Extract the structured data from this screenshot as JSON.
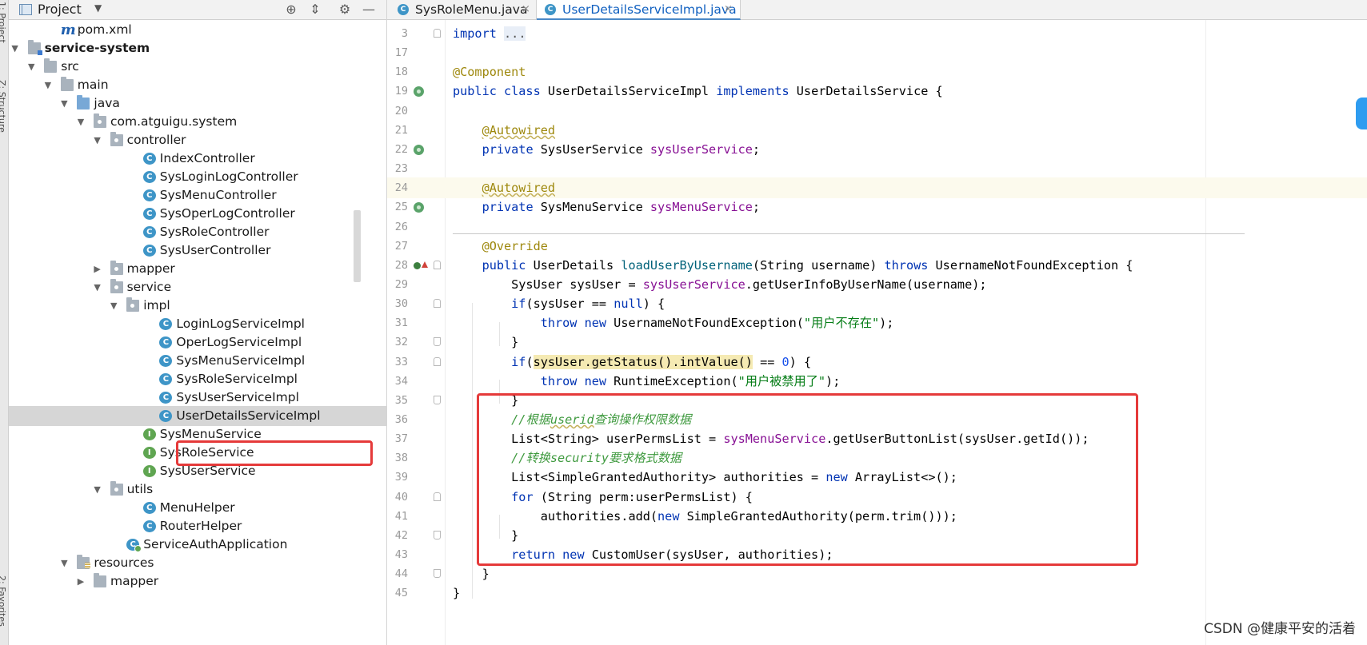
{
  "side_strip": {
    "tabs": [
      {
        "label": "1: Project",
        "icon": "project-tab"
      },
      {
        "label": "Z: Structure",
        "icon": "structure-tab"
      },
      {
        "label": "2: Favorites",
        "icon": "favorites-tab"
      }
    ]
  },
  "project_panel": {
    "title": "Project",
    "header_icons": [
      "locate-icon",
      "collapse-all-icon",
      "gear-icon",
      "minimize-icon"
    ],
    "tree": [
      {
        "label": "pom.xml",
        "icon": "maven-file-icon",
        "depth": 3,
        "arrow": ""
      },
      {
        "label": "service-system",
        "icon": "module-folder-icon",
        "depth": 1,
        "arrow": "open",
        "bold": true
      },
      {
        "label": "src",
        "icon": "folder-icon",
        "depth": 2,
        "arrow": "open"
      },
      {
        "label": "main",
        "icon": "folder-icon",
        "depth": 3,
        "arrow": "open"
      },
      {
        "label": "java",
        "icon": "source-folder-icon",
        "depth": 4,
        "arrow": "open"
      },
      {
        "label": "com.atguigu.system",
        "icon": "package-icon",
        "depth": 5,
        "arrow": "open"
      },
      {
        "label": "controller",
        "icon": "package-icon",
        "depth": 6,
        "arrow": "open"
      },
      {
        "label": "IndexController",
        "icon": "class-icon",
        "depth": 8,
        "arrow": ""
      },
      {
        "label": "SysLoginLogController",
        "icon": "class-icon",
        "depth": 8,
        "arrow": ""
      },
      {
        "label": "SysMenuController",
        "icon": "class-icon",
        "depth": 8,
        "arrow": ""
      },
      {
        "label": "SysOperLogController",
        "icon": "class-icon",
        "depth": 8,
        "arrow": ""
      },
      {
        "label": "SysRoleController",
        "icon": "class-icon",
        "depth": 8,
        "arrow": ""
      },
      {
        "label": "SysUserController",
        "icon": "class-icon",
        "depth": 8,
        "arrow": ""
      },
      {
        "label": "mapper",
        "icon": "package-icon",
        "depth": 6,
        "arrow": "closed"
      },
      {
        "label": "service",
        "icon": "package-icon",
        "depth": 6,
        "arrow": "open"
      },
      {
        "label": "impl",
        "icon": "package-icon",
        "depth": 7,
        "arrow": "open"
      },
      {
        "label": "LoginLogServiceImpl",
        "icon": "class-icon",
        "depth": 9,
        "arrow": ""
      },
      {
        "label": "OperLogServiceImpl",
        "icon": "class-icon",
        "depth": 9,
        "arrow": ""
      },
      {
        "label": "SysMenuServiceImpl",
        "icon": "class-icon",
        "depth": 9,
        "arrow": ""
      },
      {
        "label": "SysRoleServiceImpl",
        "icon": "class-icon",
        "depth": 9,
        "arrow": ""
      },
      {
        "label": "SysUserServiceImpl",
        "icon": "class-icon",
        "depth": 9,
        "arrow": ""
      },
      {
        "label": "UserDetailsServiceImpl",
        "icon": "class-icon",
        "depth": 9,
        "arrow": "",
        "selected": true,
        "highlighted": true
      },
      {
        "label": "SysMenuService",
        "icon": "interface-icon",
        "depth": 8,
        "arrow": ""
      },
      {
        "label": "SysRoleService",
        "icon": "interface-icon",
        "depth": 8,
        "arrow": ""
      },
      {
        "label": "SysUserService",
        "icon": "interface-icon",
        "depth": 8,
        "arrow": ""
      },
      {
        "label": "utils",
        "icon": "package-icon",
        "depth": 6,
        "arrow": "open"
      },
      {
        "label": "MenuHelper",
        "icon": "class-icon",
        "depth": 8,
        "arrow": ""
      },
      {
        "label": "RouterHelper",
        "icon": "class-icon",
        "depth": 8,
        "arrow": ""
      },
      {
        "label": "ServiceAuthApplication",
        "icon": "spring-app-icon",
        "depth": 7,
        "arrow": ""
      },
      {
        "label": "resources",
        "icon": "resources-folder-icon",
        "depth": 4,
        "arrow": "open"
      },
      {
        "label": "mapper",
        "icon": "folder-icon",
        "depth": 5,
        "arrow": "closed"
      }
    ]
  },
  "editor": {
    "tabs": [
      {
        "label": "SysRoleMenu.java",
        "active": false
      },
      {
        "label": "UserDetailsServiceImpl.java",
        "active": true
      }
    ],
    "close_glyph": "×",
    "lines": [
      {
        "num": "3",
        "fold": "open",
        "tokens": [
          [
            "kw",
            "import"
          ],
          [
            "p",
            " "
          ],
          [
            "foldtext",
            "..."
          ]
        ]
      },
      {
        "num": "17",
        "tokens": []
      },
      {
        "num": "18",
        "tokens": [
          [
            "ann",
            "@Component"
          ]
        ]
      },
      {
        "num": "19",
        "gutter": "bean",
        "tokens": [
          [
            "kw",
            "public class "
          ],
          [
            "p",
            "UserDetailsServiceImpl "
          ],
          [
            "kw",
            "implements "
          ],
          [
            "p",
            "UserDetailsService {"
          ]
        ]
      },
      {
        "num": "20",
        "tokens": []
      },
      {
        "num": "21",
        "tokens": [
          [
            "p",
            "    "
          ],
          [
            "annsq",
            "@Autowired"
          ]
        ]
      },
      {
        "num": "22",
        "gutter": "bean",
        "tokens": [
          [
            "p",
            "    "
          ],
          [
            "kw",
            "private "
          ],
          [
            "p",
            "SysUserService "
          ],
          [
            "fld",
            "sysUserService"
          ],
          [
            "p",
            ";"
          ]
        ]
      },
      {
        "num": "23",
        "tokens": []
      },
      {
        "num": "24",
        "highlight": true,
        "tokens": [
          [
            "p",
            "    "
          ],
          [
            "annsq",
            "@Autowired"
          ]
        ]
      },
      {
        "num": "25",
        "gutter": "bean",
        "tokens": [
          [
            "p",
            "    "
          ],
          [
            "kw",
            "private "
          ],
          [
            "p",
            "SysMenuService "
          ],
          [
            "fld",
            "sysMenuService"
          ],
          [
            "p",
            ";"
          ]
        ]
      },
      {
        "num": "26",
        "tokens": []
      },
      {
        "num": "27",
        "tokens": [
          [
            "p",
            "    "
          ],
          [
            "ann",
            "@Override"
          ]
        ]
      },
      {
        "num": "28",
        "gutter": "impl",
        "fold": "open",
        "tokens": [
          [
            "p",
            "    "
          ],
          [
            "kw",
            "public "
          ],
          [
            "p",
            "UserDetails "
          ],
          [
            "mth",
            "loadUserByUsername"
          ],
          [
            "p",
            "(String username) "
          ],
          [
            "kw",
            "throws "
          ],
          [
            "p",
            "UsernameNotFoundException {"
          ]
        ]
      },
      {
        "num": "29",
        "tokens": [
          [
            "p",
            "        SysUser sysUser = "
          ],
          [
            "fld",
            "sysUserService"
          ],
          [
            "p",
            ".getUserInfoByUserName(username);"
          ]
        ]
      },
      {
        "num": "30",
        "fold": "open",
        "tokens": [
          [
            "p",
            "        "
          ],
          [
            "kw",
            "if"
          ],
          [
            "p",
            "(sysUser == "
          ],
          [
            "kw",
            "null"
          ],
          [
            "p",
            ") {"
          ]
        ]
      },
      {
        "num": "31",
        "tokens": [
          [
            "p",
            "            "
          ],
          [
            "kw",
            "throw new "
          ],
          [
            "p",
            "UsernameNotFoundException("
          ],
          [
            "str",
            "\"用户不存在\""
          ],
          [
            "p",
            ");"
          ]
        ]
      },
      {
        "num": "32",
        "fold": "close",
        "tokens": [
          [
            "p",
            "        }"
          ]
        ]
      },
      {
        "num": "33",
        "fold": "open",
        "tokens": [
          [
            "p",
            "        "
          ],
          [
            "kw",
            "if"
          ],
          [
            "p",
            "("
          ],
          [
            "warn",
            "sysUser.getStatus().intValue()"
          ],
          [
            "p",
            " == "
          ],
          [
            "num",
            "0"
          ],
          [
            "p",
            ") {"
          ]
        ]
      },
      {
        "num": "34",
        "tokens": [
          [
            "p",
            "            "
          ],
          [
            "kw",
            "throw new "
          ],
          [
            "p",
            "RuntimeException("
          ],
          [
            "str",
            "\"用户被禁用了\""
          ],
          [
            "p",
            ");"
          ]
        ]
      },
      {
        "num": "35",
        "fold": "close",
        "tokens": [
          [
            "p",
            "        }"
          ]
        ]
      },
      {
        "num": "36",
        "tokens": [
          [
            "p",
            "        "
          ],
          [
            "cmtcn",
            "//根据"
          ],
          [
            "cmtsq",
            "userid"
          ],
          [
            "cmtcn",
            "查询操作权限数据"
          ]
        ]
      },
      {
        "num": "37",
        "tokens": [
          [
            "p",
            "        List<String> userPermsList = "
          ],
          [
            "fld",
            "sysMenuService"
          ],
          [
            "p",
            ".getUserButtonList(sysUser.getId());"
          ]
        ]
      },
      {
        "num": "38",
        "tokens": [
          [
            "p",
            "        "
          ],
          [
            "cmtcn",
            "//转换security要求格式数据"
          ]
        ]
      },
      {
        "num": "39",
        "tokens": [
          [
            "p",
            "        List<SimpleGrantedAuthority> authorities = "
          ],
          [
            "kw",
            "new "
          ],
          [
            "p",
            "ArrayList<>();"
          ]
        ]
      },
      {
        "num": "40",
        "fold": "open",
        "tokens": [
          [
            "p",
            "        "
          ],
          [
            "kw",
            "for "
          ],
          [
            "p",
            "(String perm:userPermsList) {"
          ]
        ]
      },
      {
        "num": "41",
        "tokens": [
          [
            "p",
            "            authorities.add("
          ],
          [
            "kw",
            "new "
          ],
          [
            "p",
            "SimpleGrantedAuthority(perm.trim()));"
          ]
        ]
      },
      {
        "num": "42",
        "fold": "close",
        "tokens": [
          [
            "p",
            "        }"
          ]
        ]
      },
      {
        "num": "43",
        "tokens": [
          [
            "p",
            "        "
          ],
          [
            "kw",
            "return new "
          ],
          [
            "p",
            "CustomUser(sysUser, authorities);"
          ]
        ]
      },
      {
        "num": "44",
        "fold": "close",
        "tokens": [
          [
            "p",
            "    }"
          ]
        ]
      },
      {
        "num": "45",
        "tokens": [
          [
            "p",
            "}"
          ]
        ]
      }
    ]
  },
  "watermark": "CSDN @健康平安的活着",
  "colors": {
    "accent_red": "#e53a3a",
    "keyword": "#0033b3",
    "annotation": "#9e880d",
    "field": "#871094",
    "string": "#067d17"
  }
}
